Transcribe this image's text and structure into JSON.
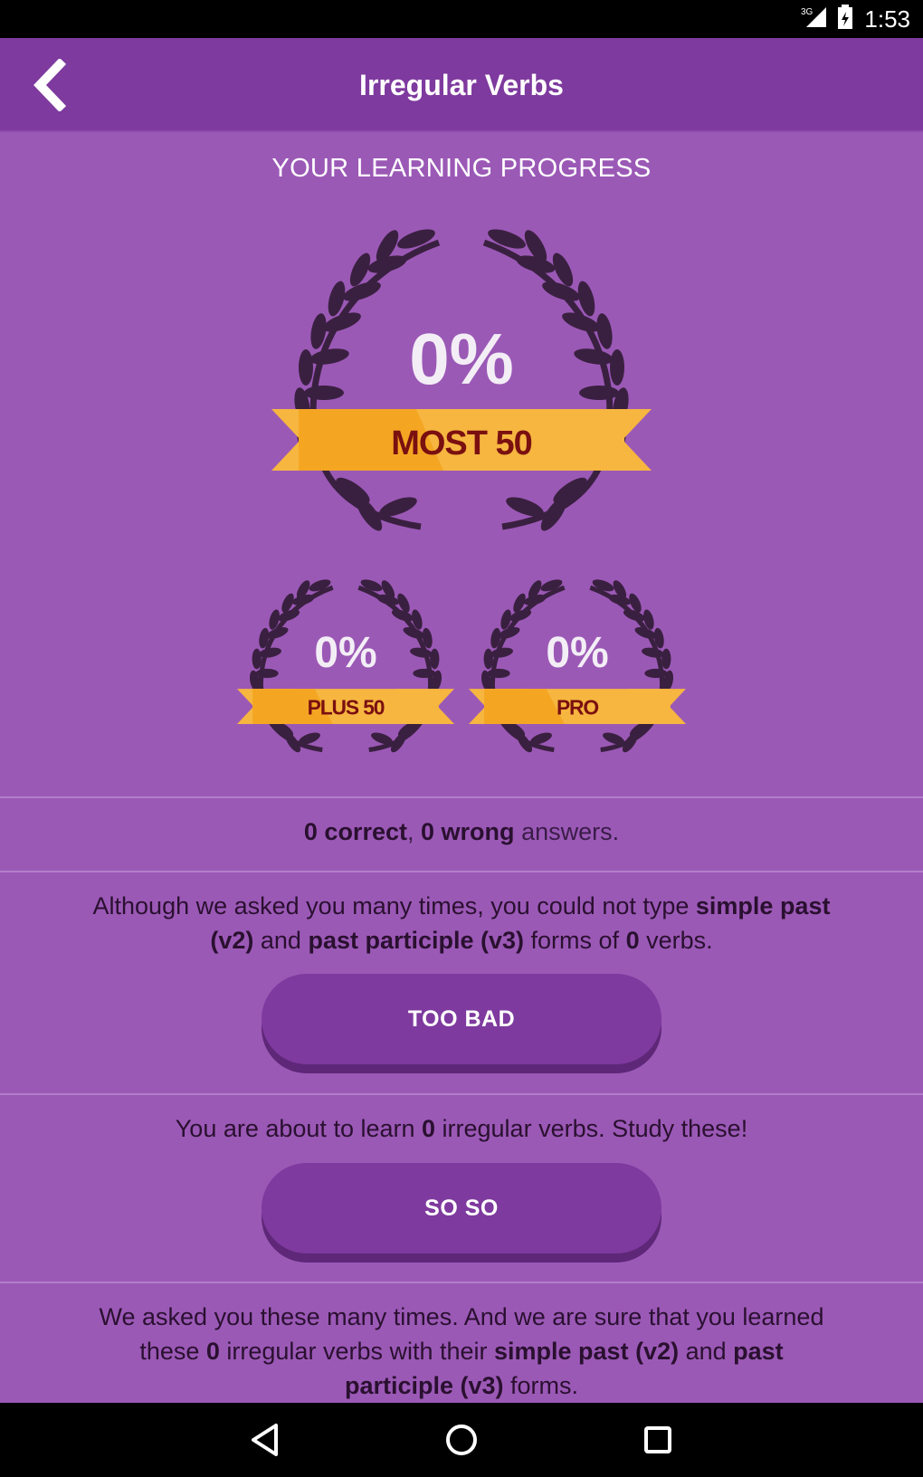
{
  "status_bar": {
    "network": "3G",
    "time": "1:53"
  },
  "app_bar": {
    "title": "Irregular Verbs"
  },
  "progress": {
    "heading": "YOUR LEARNING PROGRESS",
    "main": {
      "percent": "0%",
      "label": "MOST 50"
    },
    "plus50": {
      "percent": "0%",
      "label": "PLUS 50"
    },
    "pro": {
      "percent": "0%",
      "label": "PRO"
    }
  },
  "answers": {
    "correct_count": "0",
    "correct_word": "correct",
    "comma": ",",
    "wrong_count": "0",
    "wrong_word": "wrong",
    "tail": "answers."
  },
  "too_bad_section": {
    "t1": "Although we asked you many times, you could not type ",
    "b1": "simple past (v2)",
    "t2": " and ",
    "b2": "past participle (v3)",
    "t3": " forms of ",
    "b3": "0",
    "t4": " verbs.",
    "button_label": "TOO BAD"
  },
  "so_so_section": {
    "t1": "You are about to learn ",
    "b1": "0",
    "t2": " irregular verbs. Study these!",
    "button_label": "SO SO"
  },
  "learned_section": {
    "t1": "We asked you these many times. And we are sure that you learned these ",
    "b1": "0",
    "t2": " irregular verbs with their ",
    "b2": "simple past (v2)",
    "t3": " and ",
    "b3": "past participle (v3)",
    "t4": " forms."
  },
  "colors": {
    "background": "#9b59b6",
    "app_bar": "#7e3a9e",
    "button": "#7e3a9e",
    "ribbon": "#f6b640",
    "ribbon_text": "#7a1010",
    "laurel": "#3a2040"
  },
  "nav_icons": [
    "back-triangle-icon",
    "home-circle-icon",
    "recents-square-icon"
  ]
}
